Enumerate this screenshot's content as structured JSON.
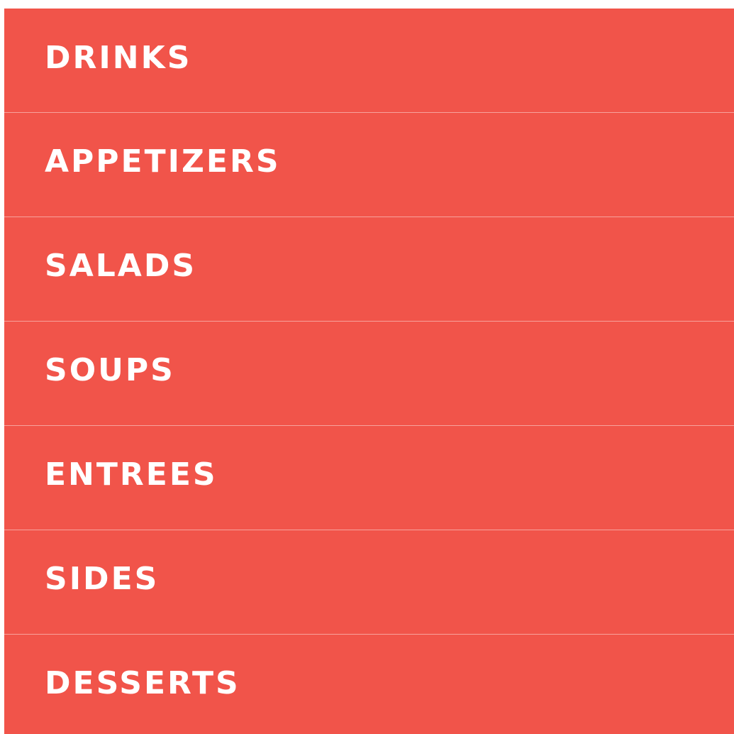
{
  "colors": {
    "menu_background": "#f1544a",
    "divider": "#f7a29c",
    "label_text": "#ffffff",
    "page_background": "#ffffff"
  },
  "menu": {
    "items": [
      {
        "label": "DRINKS"
      },
      {
        "label": "APPETIZERS"
      },
      {
        "label": "SALADS"
      },
      {
        "label": "SOUPS"
      },
      {
        "label": "ENTREES"
      },
      {
        "label": "SIDES"
      },
      {
        "label": "DESSERTS"
      }
    ]
  }
}
